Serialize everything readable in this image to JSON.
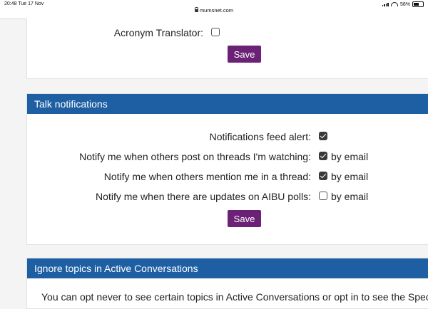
{
  "statusbar": {
    "time": "20:48",
    "date": "Tue 17 Nov",
    "url": "mumsnet.com",
    "battery": "58%"
  },
  "top_section": {
    "acronym_label": "Acronym Translator:",
    "acronym_checked": false,
    "save_label": "Save"
  },
  "talk": {
    "header": "Talk notifications",
    "rows": [
      {
        "label": "Notifications feed alert:",
        "checked": true,
        "suffix": ""
      },
      {
        "label": "Notify me when others post on threads I'm watching:",
        "checked": true,
        "suffix": "by email"
      },
      {
        "label": "Notify me when others mention me in a thread:",
        "checked": true,
        "suffix": "by email"
      },
      {
        "label": "Notify me when there are updates on AIBU polls:",
        "checked": false,
        "suffix": "by email"
      }
    ],
    "save_label": "Save"
  },
  "ignore": {
    "header": "Ignore topics in Active Conversations",
    "text": "You can opt never to see certain topics in Active Conversations or opt in to see the Spec"
  },
  "colors": {
    "header_blue": "#1e5fa3",
    "save_purple": "#6b2276"
  }
}
